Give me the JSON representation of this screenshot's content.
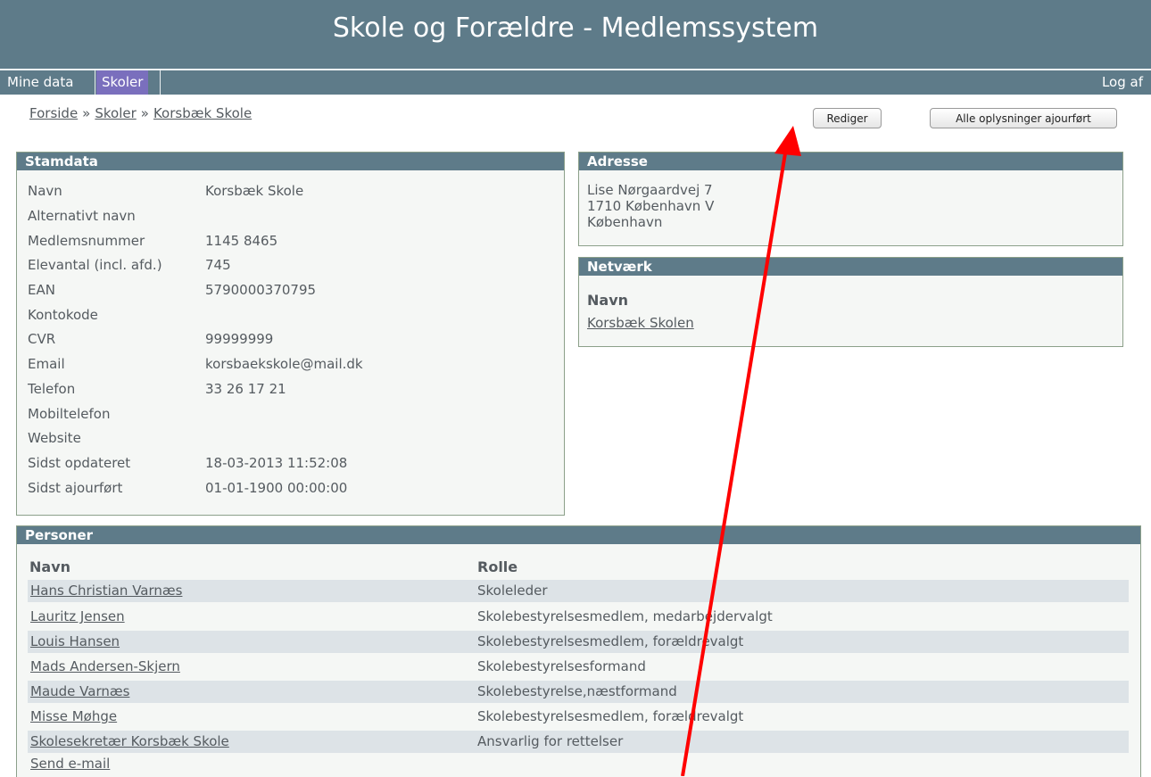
{
  "header": {
    "title": "Skole og Forældre - Medlemssystem"
  },
  "nav": {
    "mine_data": "Mine data",
    "skoler": "Skoler",
    "log_af": "Log af"
  },
  "breadcrumb": {
    "forside": "Forside",
    "sep": "»",
    "skoler": "Skoler",
    "current": "Korsbæk Skole"
  },
  "actions": {
    "rediger": "Rediger",
    "alle": "Alle oplysninger ajourført"
  },
  "stamdata": {
    "title": "Stamdata",
    "rows": [
      {
        "label": "Navn",
        "value": "Korsbæk Skole"
      },
      {
        "label": "Alternativt navn",
        "value": ""
      },
      {
        "label": "Medlemsnummer",
        "value": "1145 8465"
      },
      {
        "label": "Elevantal (incl. afd.)",
        "value": "745"
      },
      {
        "label": "EAN",
        "value": "5790000370795"
      },
      {
        "label": "Kontokode",
        "value": ""
      },
      {
        "label": "CVR",
        "value": "99999999"
      },
      {
        "label": "Email",
        "value": "korsbaekskole@mail.dk"
      },
      {
        "label": "Telefon",
        "value": "33 26 17 21"
      },
      {
        "label": "Mobiltelefon",
        "value": ""
      },
      {
        "label": "Website",
        "value": ""
      },
      {
        "label": "Sidst opdateret",
        "value": "18-03-2013 11:52:08"
      },
      {
        "label": "Sidst ajourført",
        "value": "01-01-1900 00:00:00"
      }
    ]
  },
  "adresse": {
    "title": "Adresse",
    "lines": [
      "Lise Nørgaardvej 7",
      "1710 København V",
      "København"
    ]
  },
  "netvaerk": {
    "title": "Netværk",
    "col_navn": "Navn",
    "link": "Korsbæk Skolen"
  },
  "personer": {
    "title": "Personer",
    "col_navn": "Navn",
    "col_rolle": "Rolle",
    "rows": [
      {
        "navn": "Hans Christian Varnæs",
        "rolle": "Skoleleder"
      },
      {
        "navn": "Lauritz Jensen",
        "rolle": "Skolebestyrelsesmedlem, medarbejdervalgt"
      },
      {
        "navn": "Louis Hansen",
        "rolle": "Skolebestyrelsesmedlem, forældrevalgt"
      },
      {
        "navn": "Mads Andersen-Skjern",
        "rolle": "Skolebestyrelsesformand"
      },
      {
        "navn": "Maude Varnæs",
        "rolle": "Skolebestyrelse,næstformand"
      },
      {
        "navn": "Misse Møhge",
        "rolle": "Skolebestyrelsesmedlem, forældrevalgt"
      },
      {
        "navn": "Skolesekretær Korsbæk Skole",
        "rolle": "Ansvarlig for rettelser"
      }
    ],
    "send_email": "Send e-mail"
  },
  "colors": {
    "header": "#5e7b89",
    "nav_active": "#7a6fbd",
    "row_shade": "#dde3e7",
    "annotation_arrow": "#ff0000"
  }
}
